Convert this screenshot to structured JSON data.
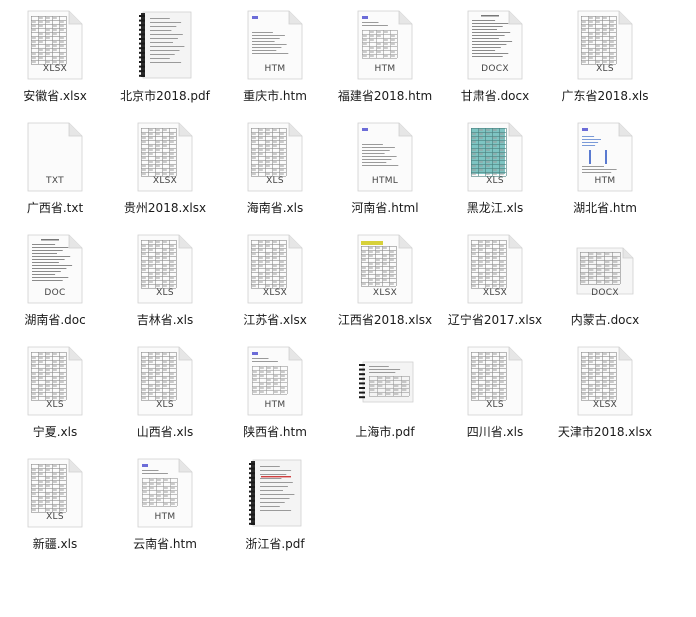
{
  "files": [
    {
      "name": "安徽省.xlsx",
      "ext": "XLSX",
      "thumb": "sheet"
    },
    {
      "name": "北京市2018.pdf",
      "ext": "",
      "thumb": "pdf"
    },
    {
      "name": "重庆市.htm",
      "ext": "HTM",
      "thumb": "html"
    },
    {
      "name": "福建省2018.htm",
      "ext": "HTM",
      "thumb": "html-table"
    },
    {
      "name": "甘肃省.docx",
      "ext": "DOCX",
      "thumb": "doc"
    },
    {
      "name": "广东省2018.xls",
      "ext": "XLS",
      "thumb": "sheet"
    },
    {
      "name": "广西省.txt",
      "ext": "TXT",
      "thumb": "blank"
    },
    {
      "name": "贵州2018.xlsx",
      "ext": "XLSX",
      "thumb": "sheet"
    },
    {
      "name": "海南省.xls",
      "ext": "XLS",
      "thumb": "sheet"
    },
    {
      "name": "河南省.html",
      "ext": "HTML",
      "thumb": "html"
    },
    {
      "name": "黑龙江.xls",
      "ext": "XLS",
      "thumb": "sheet-teal"
    },
    {
      "name": "湖北省.htm",
      "ext": "HTM",
      "thumb": "html-blue"
    },
    {
      "name": "湖南省.doc",
      "ext": "DOC",
      "thumb": "doc"
    },
    {
      "name": "吉林省.xls",
      "ext": "XLS",
      "thumb": "sheet"
    },
    {
      "name": "江苏省.xlsx",
      "ext": "XLSX",
      "thumb": "sheet"
    },
    {
      "name": "江西省2018.xlsx",
      "ext": "XLSX",
      "thumb": "sheet-yellow"
    },
    {
      "name": "辽宁省2017.xlsx",
      "ext": "XLSX",
      "thumb": "sheet"
    },
    {
      "name": "内蒙古.docx",
      "ext": "DOCX",
      "thumb": "doc-landscape"
    },
    {
      "name": "宁夏.xls",
      "ext": "XLS",
      "thumb": "sheet"
    },
    {
      "name": "山西省.xls",
      "ext": "XLS",
      "thumb": "sheet"
    },
    {
      "name": "陕西省.htm",
      "ext": "HTM",
      "thumb": "html-table"
    },
    {
      "name": "上海市.pdf",
      "ext": "",
      "thumb": "pdf-landscape"
    },
    {
      "name": "四川省.xls",
      "ext": "XLS",
      "thumb": "sheet"
    },
    {
      "name": "天津市2018.xlsx",
      "ext": "XLSX",
      "thumb": "sheet"
    },
    {
      "name": "新疆.xls",
      "ext": "XLS",
      "thumb": "sheet"
    },
    {
      "name": "云南省.htm",
      "ext": "HTM",
      "thumb": "html-table"
    },
    {
      "name": "浙江省.pdf",
      "ext": "",
      "thumb": "pdf-red"
    }
  ]
}
